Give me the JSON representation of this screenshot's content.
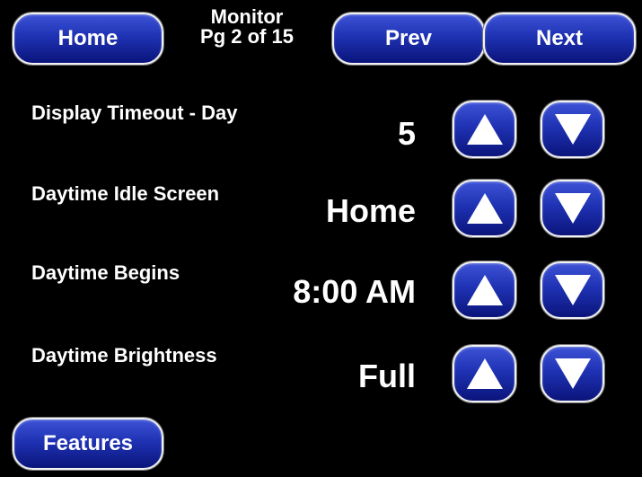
{
  "header": {
    "home_label": "Home",
    "title_line1": "Monitor",
    "title_line2": "Pg 2 of 15",
    "prev_label": "Prev",
    "next_label": "Next"
  },
  "settings": [
    {
      "label": "Display Timeout - Day",
      "value": "5"
    },
    {
      "label": "Daytime Idle Screen",
      "value": "Home"
    },
    {
      "label": "Daytime Begins",
      "value": "8:00 AM"
    },
    {
      "label": "Daytime Brightness",
      "value": "Full"
    }
  ],
  "footer": {
    "features_label": "Features"
  },
  "colors": {
    "background": "#000000",
    "button_fill": "#1f32b4",
    "button_border": "#f2f2f2",
    "text": "#ffffff"
  },
  "icons": {
    "up": "triangle-up-icon",
    "down": "triangle-down-icon"
  }
}
